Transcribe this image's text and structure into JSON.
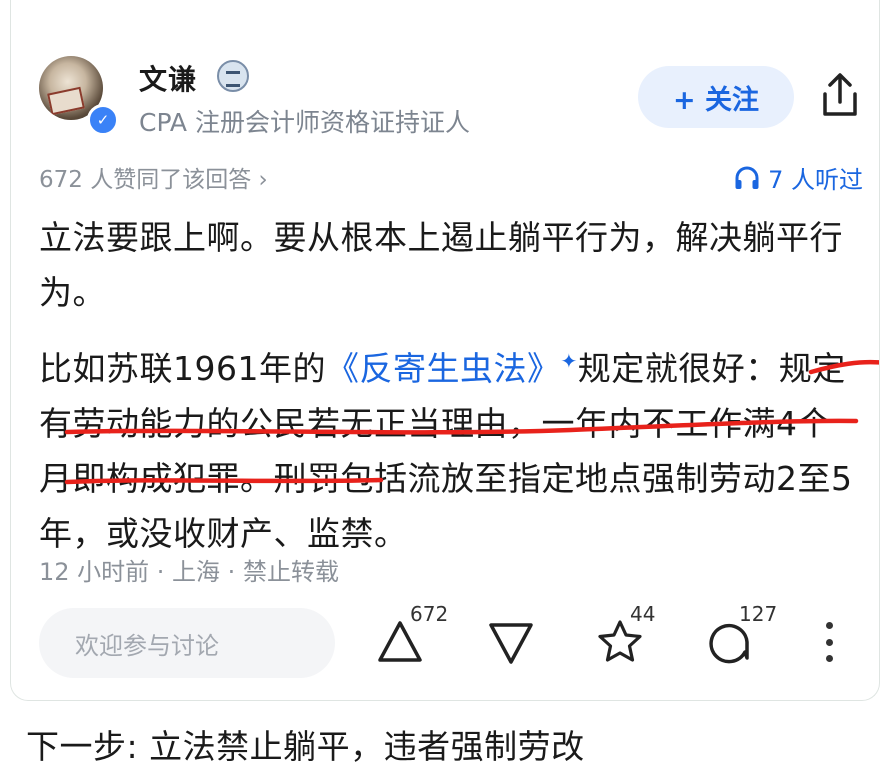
{
  "author": {
    "name": "文谦",
    "title": "CPA 注册会计师资格证持证人",
    "follow_label": "+ 关注"
  },
  "stats": {
    "likes_text": "672 人赞同了该回答 ›",
    "listen_text": "7 人听过"
  },
  "content": {
    "para1": "立法要跟上啊。要从根本上遏止躺平行为，解决躺平行为。",
    "para2_prefix": "比如苏联1961年的",
    "para2_link": "《反寄生虫法》",
    "para2_rest": "规定就很好：规定有劳动能力的公民若无正当理由，一年内不工作满4个月即构成犯罪。刑罚包括流放至指定地点强制劳动2至5年，或没收财产、监禁。"
  },
  "meta": "12 小时前 · 上海 · 禁止转载",
  "actions": {
    "comment_placeholder": "欢迎参与讨论",
    "upvote_count": "672",
    "favorite_count": "44",
    "comment_count": "127"
  },
  "caption": "下一步: 立法禁止躺平，违者强制劳改",
  "colors": {
    "accent": "#1a66e0",
    "underline": "#e8221b",
    "muted": "#8b9199"
  }
}
